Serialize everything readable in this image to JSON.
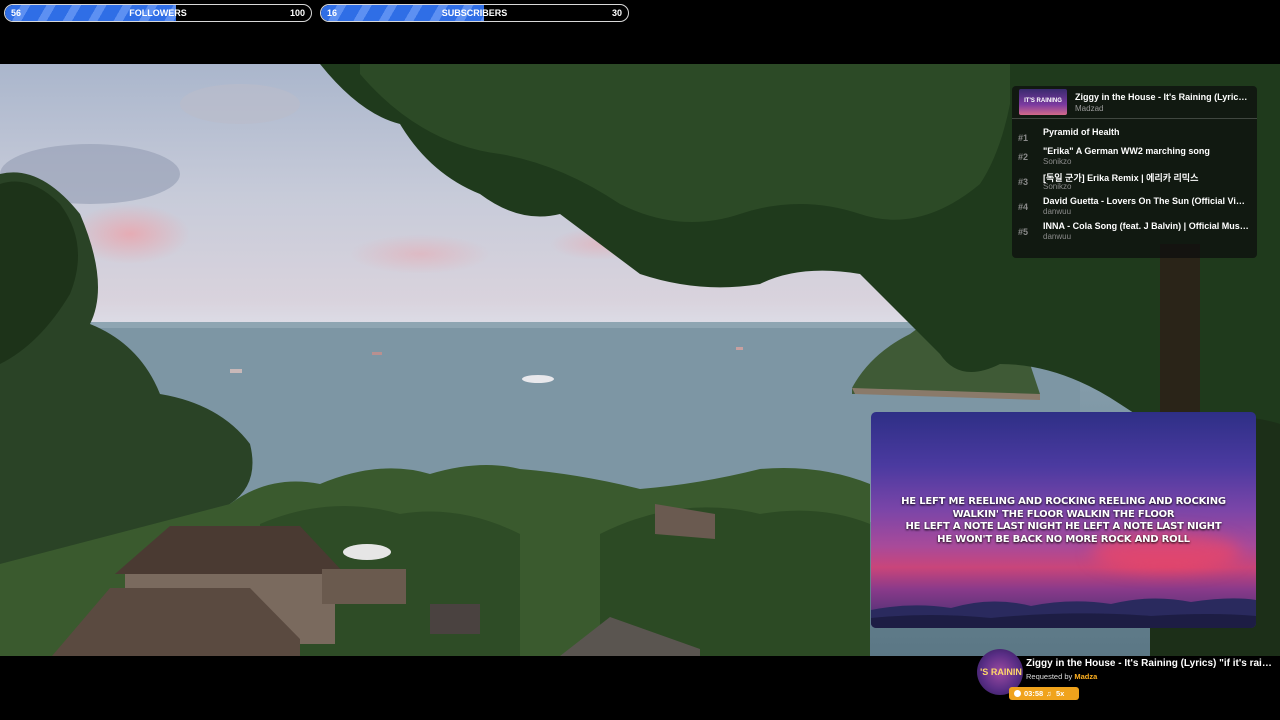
{
  "goals": [
    {
      "id": "followers",
      "current": "56",
      "title": "FOLLOWERS",
      "target": "100",
      "progress": 0.56
    },
    {
      "id": "subscribers",
      "current": "16",
      "title": "SUBSCRIBERS",
      "target": "30",
      "progress": 0.53
    }
  ],
  "queue": {
    "now_playing": {
      "thumb_label": "IT'S RAINING",
      "title": "Ziggy in the House - It's Raining (Lyrics) \"if it's raining",
      "artist": "Madzad"
    },
    "items": [
      {
        "num": "#1",
        "title": "Pyramid of Health",
        "artist": ""
      },
      {
        "num": "#2",
        "title": "\"Erika\" A German WW2 marching song",
        "artist": "Sonikzo"
      },
      {
        "num": "#3",
        "title": "[독일 군가] Erika Remix | 에리카 리믹스",
        "artist": "Sonikzo"
      },
      {
        "num": "#4",
        "title": "David Guetta - Lovers On The Sun (Official Video)",
        "artist": "danwuu"
      },
      {
        "num": "#5",
        "title": "INNA - Cola Song (feat. J Balvin) | Official Music Video",
        "artist": "danwuu"
      }
    ]
  },
  "lyrics": [
    "HE LEFT ME REELING AND ROCKING  REELING AND ROCKING",
    "WALKIN' THE FLOOR  WALKIN THE FLOOR",
    "HE LEFT A NOTE LAST NIGHT  HE LEFT A NOTE LAST NIGHT",
    "HE WON'T BE BACK NO MORE  ROCK AND ROLL"
  ],
  "now_playing_bar": {
    "disc_label": "'S RAININ",
    "title": "Ziggy in the House - It's Raining (Lyrics) \"if it's raining",
    "requested_prefix": "Requested by",
    "requester": "Madza",
    "duration": "03:58",
    "queue_count": "5x",
    "accent": "#f0a31c"
  }
}
